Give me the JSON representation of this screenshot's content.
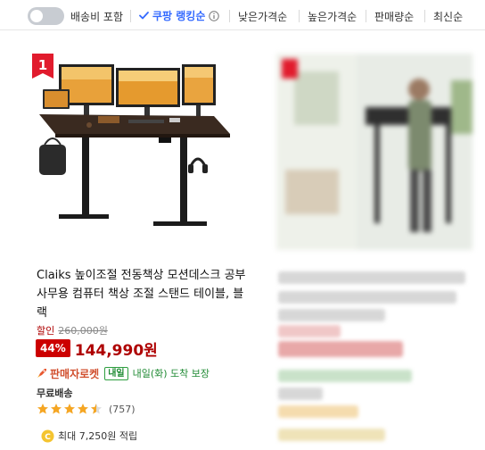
{
  "sort_bar": {
    "toggle_on": false,
    "shipping_toggle_label": "배송비 포함",
    "active_sort_label": "쿠팡 랭킹순",
    "sort_options": [
      "낮은가격순",
      "높은가격순",
      "판매량순",
      "최신순"
    ]
  },
  "product": {
    "rank": "1",
    "title": "Claiks 높이조절 전동책상 모션데스크 공부 사무용 컴퓨터 책상 조절 스탠드 테이블, 블랙",
    "discount_label": "할인",
    "original_price": "260,000원",
    "discount_rate": "44%",
    "sale_price": "144,990원",
    "rocket_label": "판매자로켓",
    "delivery_badge": "내일",
    "delivery_text": "내일(화) 도착 보장",
    "free_shipping": "무료배송",
    "rating": 4.5,
    "review_count": "(757)",
    "reward_text": "최대 7,250원 적립"
  },
  "colors": {
    "accent_blue": "#346aff",
    "price_red": "#ae0000",
    "badge_red": "#cc0000",
    "delivery_green": "#1f8a33",
    "rocket_orange": "#d14f2e",
    "star_orange": "#f5a623"
  },
  "icons": {
    "check": "check-icon",
    "info": "info-icon",
    "rocket": "rocket-icon",
    "star": "star-icon",
    "coin": "coin-icon"
  }
}
